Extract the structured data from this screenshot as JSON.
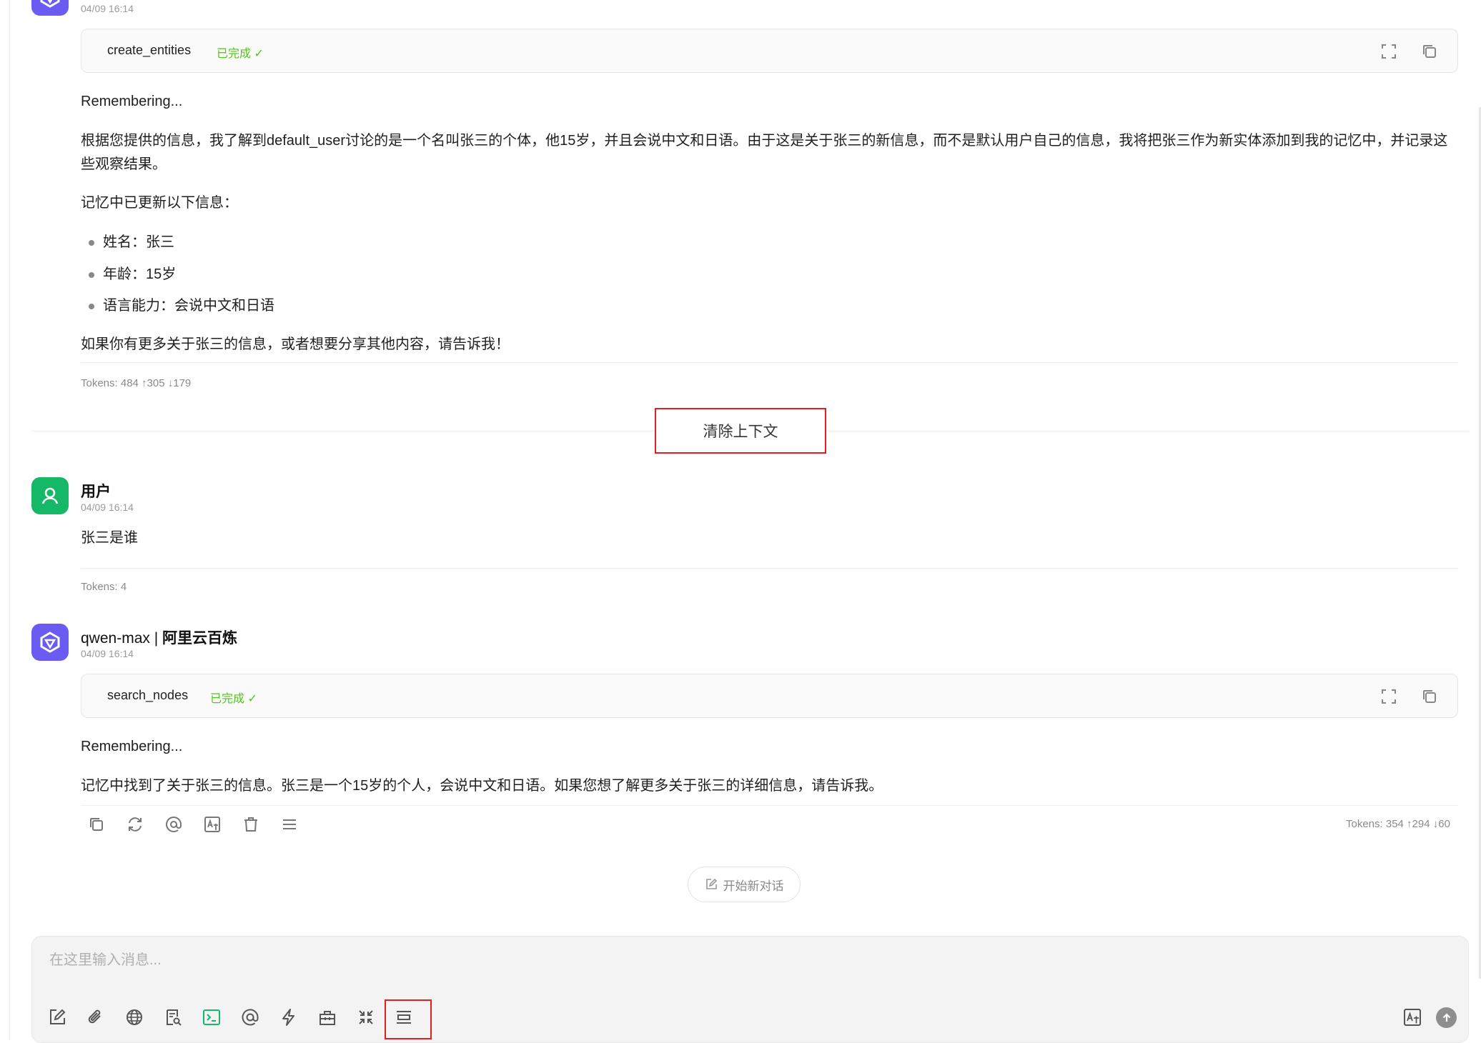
{
  "colors": {
    "accent_ai": "#6a5cf2",
    "accent_user": "#14b866",
    "status_done": "#52c41a",
    "highlight": "#e02020"
  },
  "messages": [
    {
      "role": "assistant",
      "time": "04/09 16:14",
      "tool": {
        "name": "create_entities",
        "status": "已完成 ✓"
      },
      "status_line": "Remembering...",
      "paragraph": "根据您提供的信息，我了解到default_user讨论的是一个名叫张三的个体，他15岁，并且会说中文和日语。由于这是关于张三的新信息，而不是默认用户自己的信息，我将把张三作为新实体添加到我的记忆中，并记录这些观察结果。",
      "list_intro": "记忆中已更新以下信息：",
      "list": [
        "姓名：张三",
        "年龄：15岁",
        "语言能力：会说中文和日语"
      ],
      "closing": "如果你有更多关于张三的信息，或者想要分享其他内容，请告诉我！",
      "tokens": "Tokens: 484 ↑305 ↓179"
    },
    {
      "role": "user",
      "name": "用户",
      "time": "04/09 16:14",
      "text": "张三是谁",
      "tokens": "Tokens: 4"
    },
    {
      "role": "assistant",
      "model": "qwen-max",
      "separator": " | ",
      "provider": "阿里云百炼",
      "time": "04/09 16:14",
      "tool": {
        "name": "search_nodes",
        "status": "已完成 ✓"
      },
      "status_line": "Remembering...",
      "text": "记忆中找到了关于张三的信息。张三是一个15岁的个人，会说中文和日语。如果您想了解更多关于张三的详细信息，请告诉我。",
      "tokens": "Tokens: 354 ↑294 ↓60"
    }
  ],
  "clear_context_label": "清除上下文",
  "new_chat_label": "开始新对话",
  "input": {
    "placeholder": "在这里输入消息...",
    "value": ""
  },
  "icons": {
    "tool_actions": [
      "expand-icon",
      "copy-icon"
    ],
    "message_actions": [
      "copy-icon",
      "refresh-icon",
      "at-icon",
      "translate-icon",
      "delete-icon",
      "menu-icon"
    ],
    "toolbar": [
      "edit-icon",
      "paperclip-icon",
      "globe-icon",
      "knowledge-search-icon",
      "terminal-icon",
      "at-icon",
      "lightning-icon",
      "toolbox-icon",
      "collapse-icon",
      "clear-context-icon"
    ],
    "toolbar_right": [
      "translate-icon",
      "send-icon"
    ]
  }
}
